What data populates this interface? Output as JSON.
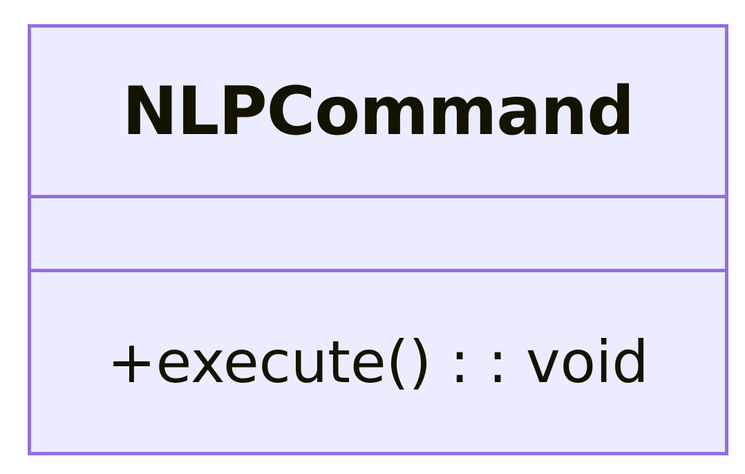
{
  "diagram": {
    "class": {
      "name": "NLPCommand",
      "attributes": [],
      "methods": [
        "+execute() : : void"
      ]
    },
    "colors": {
      "fill": "#ececff",
      "border": "#9370db",
      "text": "#131300"
    }
  }
}
